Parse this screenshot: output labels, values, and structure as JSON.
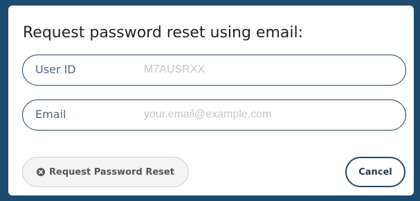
{
  "dialog": {
    "title": "Request password reset using email:",
    "fields": {
      "user_id": {
        "label": "User ID",
        "value": "",
        "placeholder": "M7AUSRXX"
      },
      "email": {
        "label": "Email",
        "value": "",
        "placeholder": "your.email@example.com"
      }
    },
    "buttons": {
      "request_reset": {
        "label": "Request Password Reset",
        "icon": "cancel-circle-icon",
        "disabled": true
      },
      "cancel": {
        "label": "Cancel"
      }
    }
  },
  "colors": {
    "accent": "#1e4a6d",
    "disabled_border": "#cfcfcf",
    "placeholder": "#c5c5c5"
  }
}
